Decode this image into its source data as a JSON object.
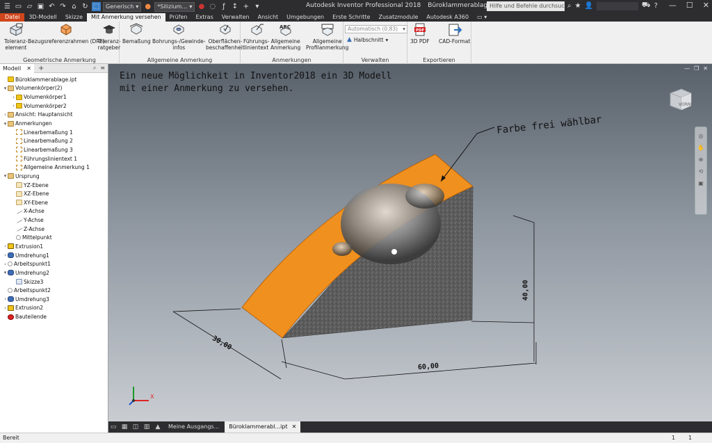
{
  "quick_access": {
    "appearance_combo": "Generisch",
    "material_combo": "*Silizium…"
  },
  "title": {
    "app": "Autodesk Inventor Professional 2018",
    "file": "Büroklammerablage.ipt"
  },
  "help_search_placeholder": "Hilfe und Befehle durchsuchen...",
  "tabs": [
    "Datei",
    "3D-Modell",
    "Skizze",
    "Mit Anmerkung versehen",
    "Prüfen",
    "Extras",
    "Verwalten",
    "Ansicht",
    "Umgebungen",
    "Erste Schritte",
    "Zusatzmodule",
    "Autodesk A360"
  ],
  "ribbon": {
    "geom": {
      "title": "Geometrische Anmerkung",
      "b1": "Toleranz-\nelement",
      "b2": "Bezugsreferenzrahmen (DRF)",
      "b3": "Toleranz-\nratgeber"
    },
    "allg": {
      "title": "Allgemeine Anmerkung",
      "b1": "Bemaßung",
      "b2": "Bohrungs-/Gewinde-\ninfos",
      "b3": "Oberflächen-\nbeschaffenheit"
    },
    "anm": {
      "title": "Anmerkungen",
      "b1": "Führungs-\nlinientext",
      "b2": "Allgemeine\nAnmerkung",
      "b3": "Allgemeine\nProfilanmerkung"
    },
    "verw": {
      "title": "Verwalten",
      "dropdown": "Automatisch (0,83)",
      "halbschnitt": "Halbschnitt"
    },
    "exp": {
      "title": "Exportieren",
      "b1": "3D PDF",
      "b2": "CAD-Format"
    }
  },
  "panel": {
    "tab": "Modell",
    "tree": [
      {
        "label": "Büroklammerablage.ipt",
        "icon": "part",
        "indent": 0,
        "exp": ""
      },
      {
        "label": "Volumenkörper(2)",
        "icon": "folder",
        "indent": 0,
        "exp": "▾"
      },
      {
        "label": "Volumenkörper1",
        "icon": "part",
        "indent": 1,
        "exp": "›"
      },
      {
        "label": "Volumenkörper2",
        "icon": "part",
        "indent": 1,
        "exp": "›"
      },
      {
        "label": "Ansicht: Hauptansicht",
        "icon": "folder",
        "indent": 0,
        "exp": "›"
      },
      {
        "label": "Anmerkungen",
        "icon": "folder",
        "indent": 0,
        "exp": "▾"
      },
      {
        "label": "Linearbemaßung 1",
        "icon": "dim",
        "indent": 1,
        "exp": ""
      },
      {
        "label": "Linearbemaßung 2",
        "icon": "dim",
        "indent": 1,
        "exp": ""
      },
      {
        "label": "Linearbemaßung 3",
        "icon": "dim",
        "indent": 1,
        "exp": ""
      },
      {
        "label": "Führungslinientext 1",
        "icon": "dim",
        "indent": 1,
        "exp": ""
      },
      {
        "label": "Allgemeine Anmerkung 1",
        "icon": "dim",
        "indent": 1,
        "exp": ""
      },
      {
        "label": "Ursprung",
        "icon": "folder",
        "indent": 0,
        "exp": "▾"
      },
      {
        "label": "YZ-Ebene",
        "icon": "plane",
        "indent": 1,
        "exp": ""
      },
      {
        "label": "XZ-Ebene",
        "icon": "plane",
        "indent": 1,
        "exp": ""
      },
      {
        "label": "XY-Ebene",
        "icon": "plane",
        "indent": 1,
        "exp": ""
      },
      {
        "label": "X-Achse",
        "icon": "axis",
        "indent": 1,
        "exp": ""
      },
      {
        "label": "Y-Achse",
        "icon": "axis",
        "indent": 1,
        "exp": ""
      },
      {
        "label": "Z-Achse",
        "icon": "axis",
        "indent": 1,
        "exp": ""
      },
      {
        "label": "Mittelpunkt",
        "icon": "point",
        "indent": 1,
        "exp": ""
      },
      {
        "label": "Extrusion1",
        "icon": "extr",
        "indent": 0,
        "exp": "›"
      },
      {
        "label": "Umdrehung1",
        "icon": "rev",
        "indent": 0,
        "exp": "›"
      },
      {
        "label": "Arbeitspunkt1",
        "icon": "point",
        "indent": 0,
        "exp": "›"
      },
      {
        "label": "Umdrehung2",
        "icon": "rev",
        "indent": 0,
        "exp": "▾"
      },
      {
        "label": "Skizze3",
        "icon": "sketch",
        "indent": 1,
        "exp": ""
      },
      {
        "label": "Arbeitspunkt2",
        "icon": "point",
        "indent": 0,
        "exp": ""
      },
      {
        "label": "Umdrehung3",
        "icon": "rev",
        "indent": 0,
        "exp": "›"
      },
      {
        "label": "Extrusion2",
        "icon": "extr",
        "indent": 0,
        "exp": "›"
      },
      {
        "label": "Bauteilende",
        "icon": "end",
        "indent": 0,
        "exp": ""
      }
    ]
  },
  "viewport": {
    "note": "Ein neue Möglichkeit in Inventor2018 ein 3D Modell\nmit einer Anmerkung zu versehen.",
    "leader_text": "Farbe frei wählbar",
    "dim_width": "60,00",
    "dim_height": "40,00",
    "dim_depth": "30,00",
    "viewcube_label": "VORNE",
    "triad_x": "X"
  },
  "doctabs": {
    "home": "Meine Ausgangs...",
    "active": "Büroklammerabl...ipt"
  },
  "status": {
    "text": "Bereit",
    "n1": "1",
    "n2": "1"
  }
}
